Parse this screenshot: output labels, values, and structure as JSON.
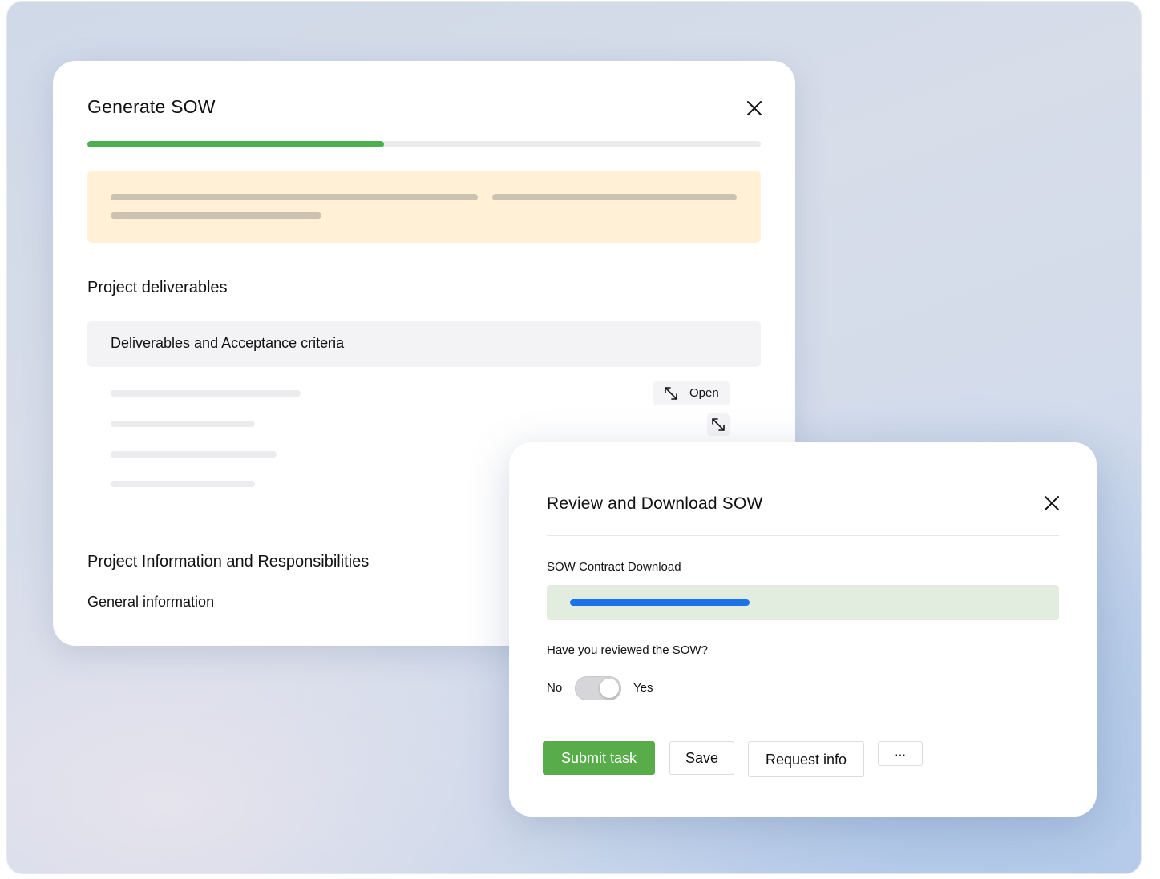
{
  "colors": {
    "progress_fill": "#4caf50",
    "notice_bg": "#fff0d6",
    "primary_button": "#58ac4a",
    "download_bar": "#1a73e8",
    "download_bg": "#e2eddf"
  },
  "generate_sow": {
    "title": "Generate SOW",
    "close_icon": "close-icon",
    "progress": 0.44,
    "section_deliverables": {
      "title": "Project deliverables",
      "accordion_label": "Deliverables and Acceptance criteria",
      "open_label": "Open",
      "open_icon": "expand-arrows-icon"
    },
    "section_info": {
      "title": "Project Information and Responsibilities",
      "subtitle": "General information"
    }
  },
  "review_sow": {
    "title": "Review and Download SOW",
    "close_icon": "close-icon",
    "download_label": "SOW Contract Download",
    "download_progress": 0.35,
    "question": "Have you reviewed the SOW?",
    "toggle": {
      "off_label": "No",
      "on_label": "Yes",
      "value": "Yes"
    },
    "buttons": {
      "submit": "Submit task",
      "save": "Save",
      "request_info": "Request info",
      "more": "···"
    }
  }
}
